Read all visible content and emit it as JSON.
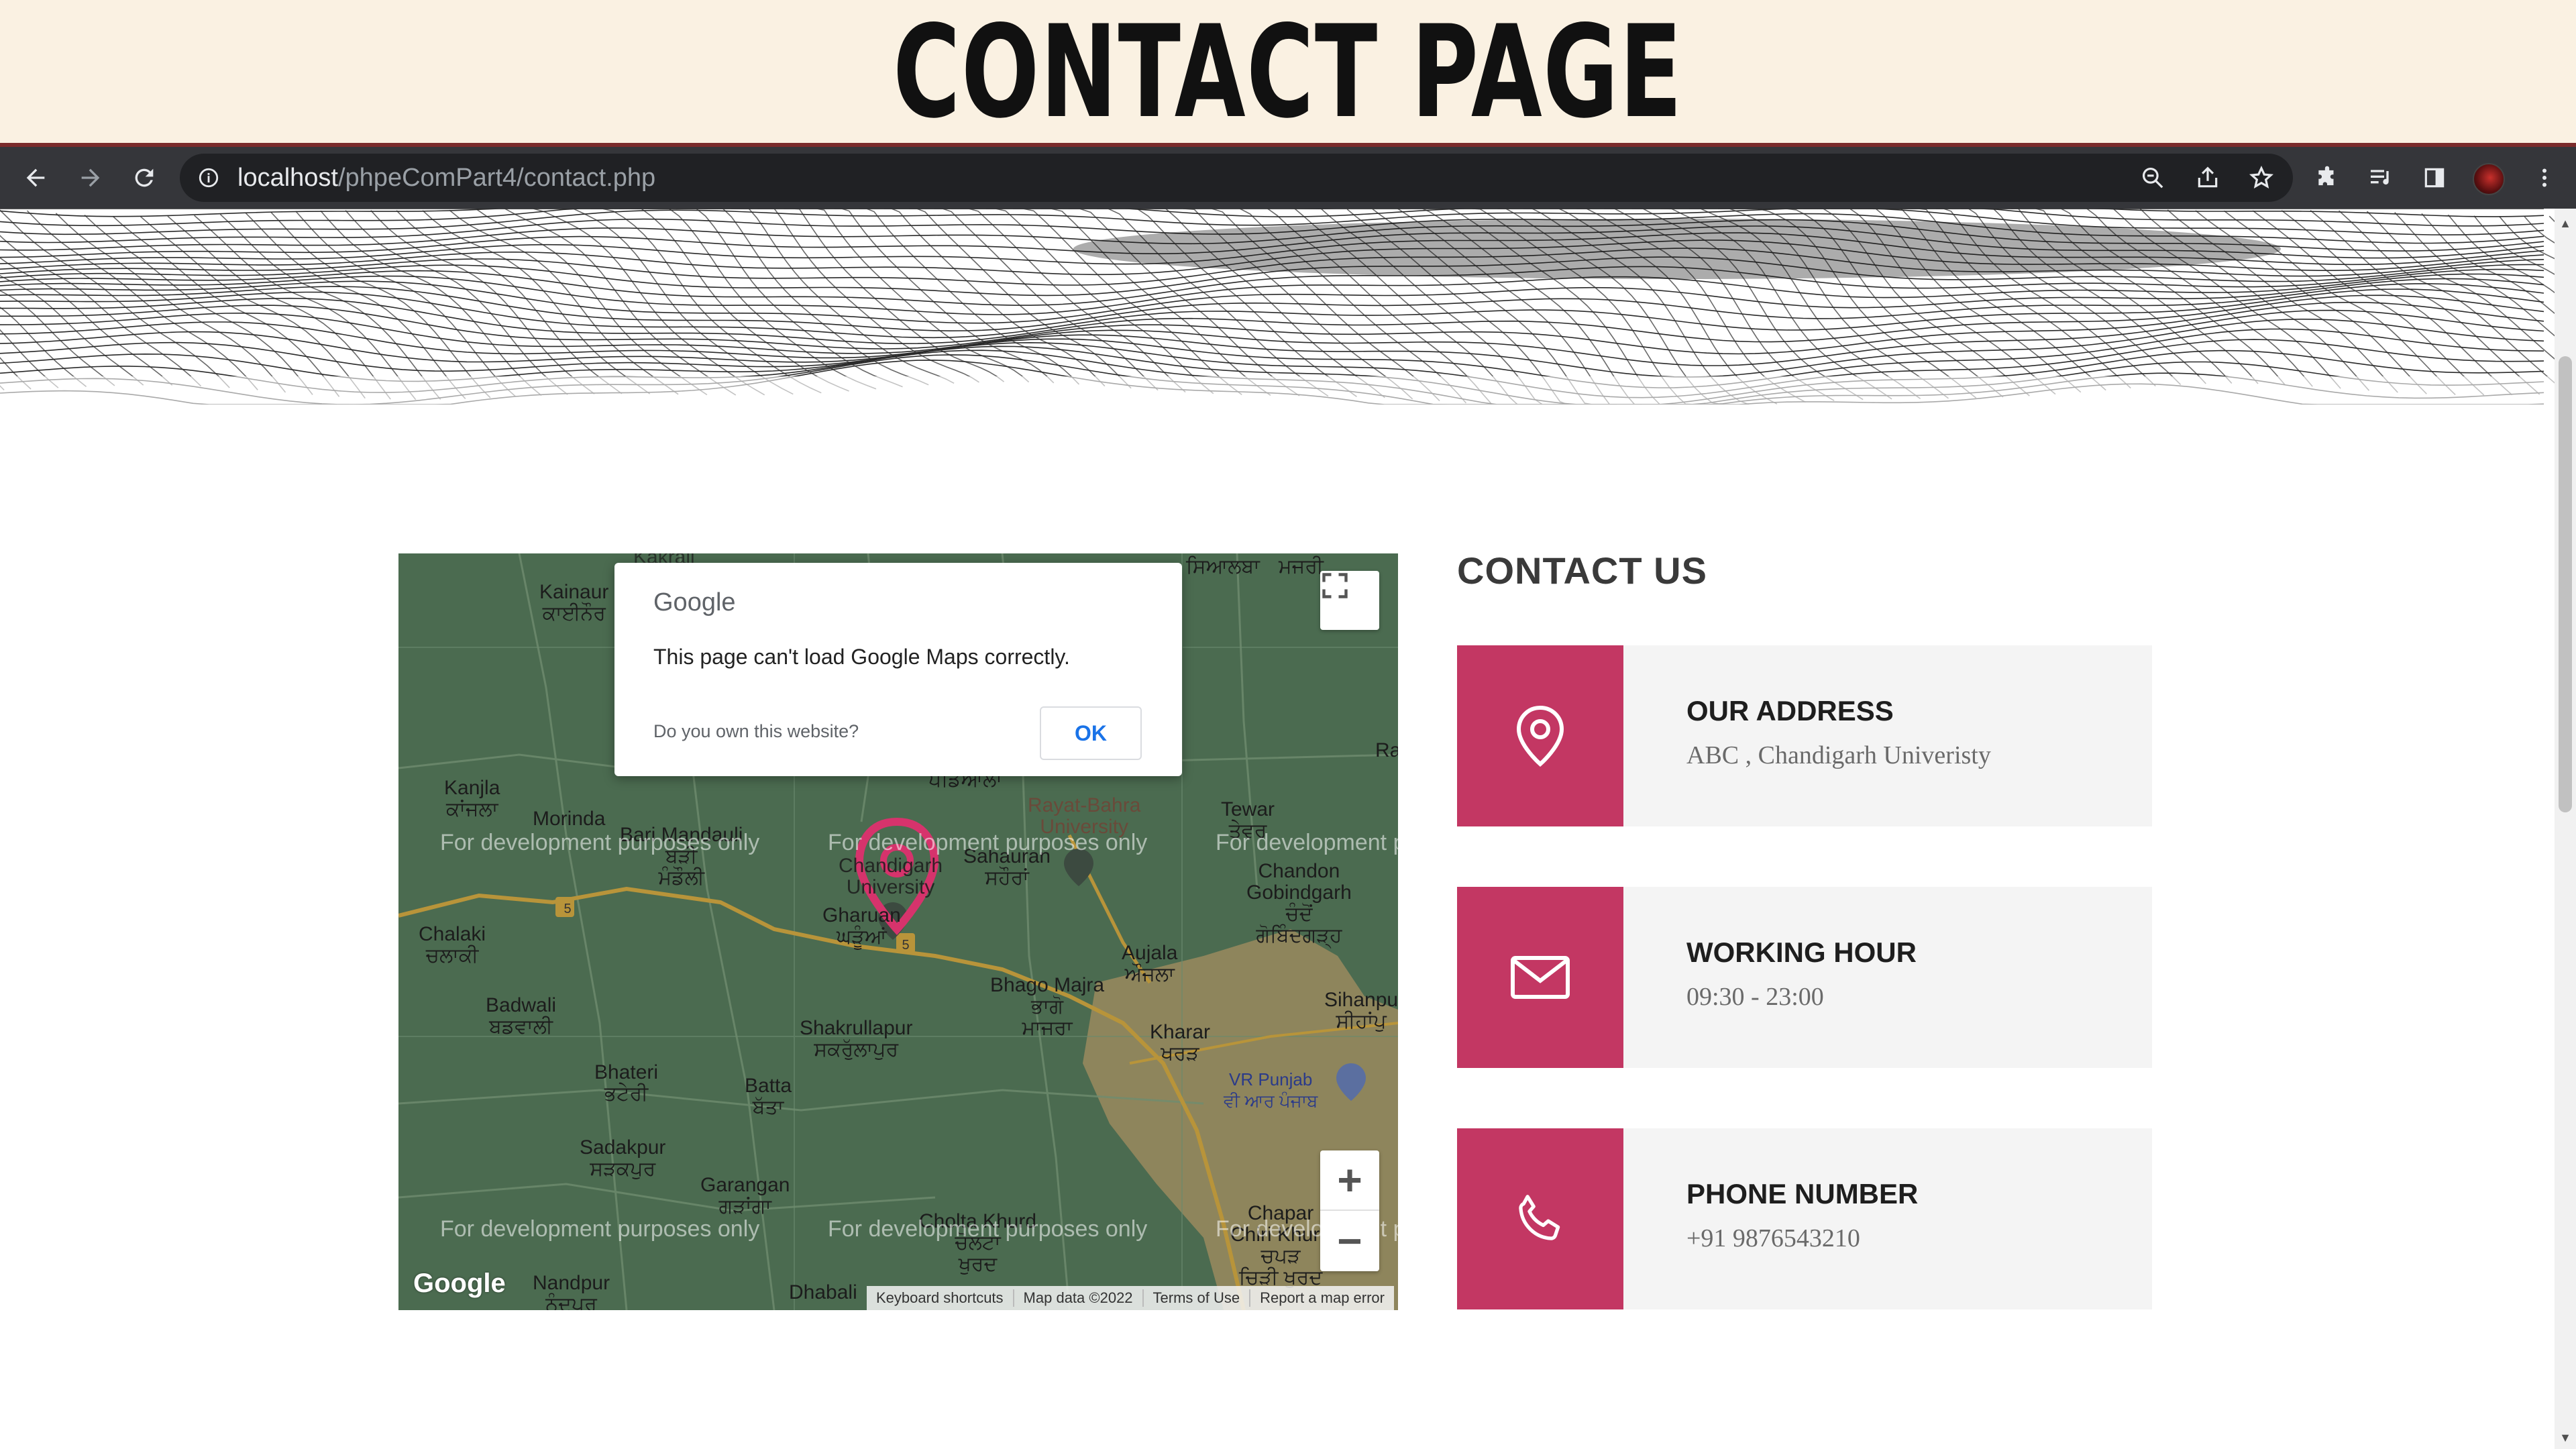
{
  "banner": {
    "title": "CONTACT PAGE"
  },
  "browser": {
    "url_host": "localhost",
    "url_path": "/phpeComPart4/contact.php",
    "icons": [
      "back-icon",
      "forward-icon",
      "reload-icon",
      "info-icon",
      "zoom-out-icon",
      "share-icon",
      "star-icon",
      "extensions-icon",
      "media-queue-icon",
      "side-panel-icon",
      "profile-avatar",
      "menu-icon"
    ]
  },
  "map": {
    "dialog": {
      "brand": "Google",
      "message": "This page can't load Google Maps correctly.",
      "own_question": "Do you own this website?",
      "ok_label": "OK"
    },
    "watermark": "For development purposes only",
    "places": {
      "kainaur": "Kainaur\nਕਾਈਨੌਰ",
      "kanjla": "Kanjla\nਕਾਂਜਲਾ",
      "morinda": "Morinda",
      "bari_mandauli": "Bari Mandauli\nਬੜੀ\nਮੰਡੌਲੀ",
      "chalaki": "Chalaki\nਚਲਾਕੀ",
      "gharuan": "Gharuan\nਘੜੂੰਆਂ",
      "chandigarh_univ": "Chandigarh\nUniversity",
      "sahauran": "Sahauran\nਸਹੌਰਾਂ",
      "rayat_bahra": "Rayat-Bahra\nUniversity",
      "padiala": "ਪਡਿਆਲਾ",
      "tewar": "Tewar\nਤੇਵਰ",
      "chandon_gobindgarh": "Chandon\nGobindgarh\nਚੰਦੋਂ\nਗੋਬਿੰਦਗੜ੍ਹ",
      "aujala": "Aujala\nਔਜਲਾ",
      "bhago_majra": "Bhago Majra\nਭਾਗੋ\nਮਾਜਰਾ",
      "badwali": "Badwali\nਬਡਵਾਲੀ",
      "shakrullapur": "Shakrullapur\nਸਕਰੁੱਲਾਪੁਰ",
      "kharar": "Kharar\nਖਰੜ",
      "vr_punjab": "VR Punjab\nਵੀ ਆਰ ਪੰਜਾਬ",
      "sihanpur": "Sihanpu\nਸੀਹਾਂਪੁ",
      "bhateri": "Bhateri\nਭਟੇਰੀ",
      "batta": "Batta\nਬੱਤਾ",
      "sadakpur": "Sadakpur\nਸੜਕਪੁਰ",
      "garangan": "Garangan\nਗੜਾਂਗਾ",
      "cholta_khurd": "Cholta Khurd\nਚੋਲਟਾ\nਖੁਰਦ",
      "chapar_chiri": "Chapar\nChiri Khurd\nਚਪੜ\nਚਿੜੀ ਖੁਰਦ",
      "nandpur": "Nandpur\nਨੰਦਪੁਰ",
      "dhabali": "Dhabali",
      "siarba": "ਸਿਆਲਬਾ",
      "majri": "ਮਜਰੀ",
      "ra": "Ra",
      "road_5a": "5",
      "road_5b": "5",
      "kakrali": "Kakrali"
    },
    "zoom_in": "+",
    "zoom_out": "−",
    "logo": "Google",
    "footer": [
      "Keyboard shortcuts",
      "Map data ©2022",
      "Terms of Use",
      "Report a map error"
    ]
  },
  "contact": {
    "title": "CONTACT US",
    "cards": [
      {
        "icon": "location-pin-icon",
        "heading": "OUR ADDRESS",
        "value": "ABC , Chandigarh Univeristy"
      },
      {
        "icon": "envelope-icon",
        "heading": "WORKING HOUR",
        "value": "09:30 - 23:00"
      },
      {
        "icon": "phone-icon",
        "heading": "PHONE NUMBER",
        "value": "+91 9876543210"
      }
    ]
  },
  "colors": {
    "banner_bg": "#faf1e2",
    "accent": "#c33763",
    "card_bg": "#f4f4f4",
    "map_green": "#4b6b50",
    "map_urban": "#9a8a5e",
    "toolbar_bg": "#35363a"
  }
}
